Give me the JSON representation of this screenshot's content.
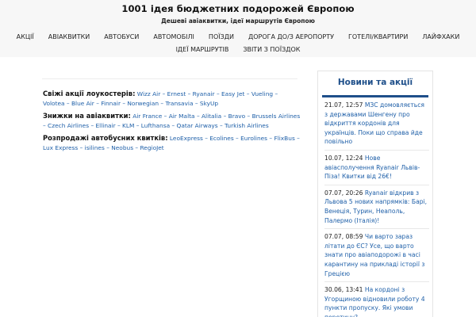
{
  "header": {
    "title": "1001 ідея бюджетних подорожей Європою",
    "tagline": "Дешеві авіаквитки, ідеї маршрутів Європою"
  },
  "nav": {
    "row1": [
      "АКЦІЇ",
      "АВІАКВИТКИ",
      "АВТОБУСИ",
      "АВТОМОБІЛІ",
      "ПОЇЗДИ",
      "ДОРОГА ДО/З АЕРОПОРТУ",
      "ГОТЕЛІ/КВАРТИРИ",
      "ЛАЙФХАКИ"
    ],
    "row2": [
      "ІДЕЇ МАРШРУТІВ",
      "ЗВІТИ З ПОЇЗДОК"
    ]
  },
  "content": {
    "blocks": [
      {
        "label": "Свіжі акції лоукостерів:",
        "links": [
          "Wizz Air",
          "Ernest",
          "Ryanair",
          "Easy Jet",
          "Vueling",
          "Volotea",
          "Blue Air",
          "Finnair",
          "Norwegian",
          "Transavia",
          "SkyUp"
        ]
      },
      {
        "label": "Знижки на авіаквитки:",
        "links": [
          "Air France",
          "Air Malta",
          "Alitalia",
          "Bravo",
          "Brussels Airlines",
          "Czech Airlines",
          "Ellinair",
          "KLM",
          "Lufthansa",
          "Qatar Airways",
          "Turkish Airlines"
        ]
      },
      {
        "label": "Розпродажі автобусних квитків:",
        "links": [
          "LeoExpress",
          "Ecolines",
          "Eurolines",
          "FlixBus",
          "Lux Express",
          "isilines",
          "Neobus",
          "RegioJet"
        ]
      }
    ],
    "separator": "–"
  },
  "sidebar": {
    "title": "Новини та акції",
    "news": [
      {
        "date": "21.07, 12:57",
        "text": "МЗС домовляється з державами Шенгену про відкриття кордонів для українців. Поки що справа йде повільно"
      },
      {
        "date": "10.07, 12:24",
        "text": "Нове авіасполучення Ryanair Львів-Піза! Квитки від 26€!"
      },
      {
        "date": "07.07, 20:26",
        "text": "Ryanair відкрив з Львова 5 нових напрямків: Барі, Венеція, Турин, Неаполь, Палермо (Італія)!"
      },
      {
        "date": "07.07, 08:59",
        "text": "Чи варто зараз літати до ЄС? Усе, що варто знати про авіаподорожі в часі карантину на прикладі історії з Грецією"
      },
      {
        "date": "30.06, 13:41",
        "text": "На кордоні з Угорщиною відновили роботу 4 пункти пропуску. Які умови перетину?"
      }
    ]
  }
}
